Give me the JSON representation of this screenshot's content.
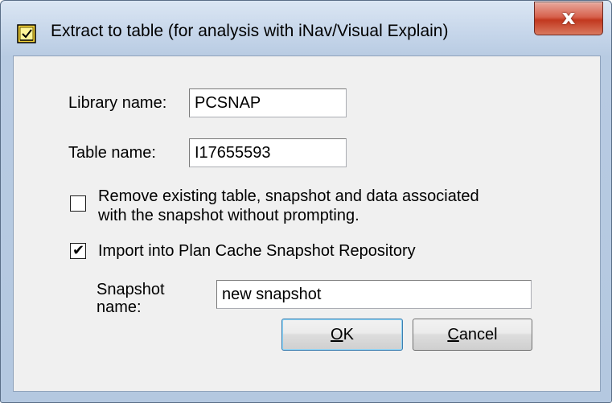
{
  "window": {
    "title": "Extract to table (for analysis with iNav/Visual Explain)",
    "title_icon": "table-extract-icon",
    "close_glyph": "x"
  },
  "form": {
    "library_label": "Library name:",
    "library_value": "PCSNAP",
    "table_label": "Table name:",
    "table_value": "I17655593",
    "remove_label_line1": "Remove existing table, snapshot and data associated",
    "remove_label_line2": "with the snapshot without prompting.",
    "remove_checked": false,
    "import_label": "Import into Plan Cache Snapshot Repository",
    "import_checked": true,
    "snapshot_label_line1": "Snapshot",
    "snapshot_label_line2": "name:",
    "snapshot_value": "new snapshot"
  },
  "buttons": {
    "ok_mnemonic": "O",
    "ok_rest": "K",
    "cancel_mnemonic": "C",
    "cancel_rest": "ancel"
  },
  "colors": {
    "close_button": "#c7432b",
    "title_bar": "#c6d6ea",
    "dialog_face": "#f0f0f0"
  }
}
